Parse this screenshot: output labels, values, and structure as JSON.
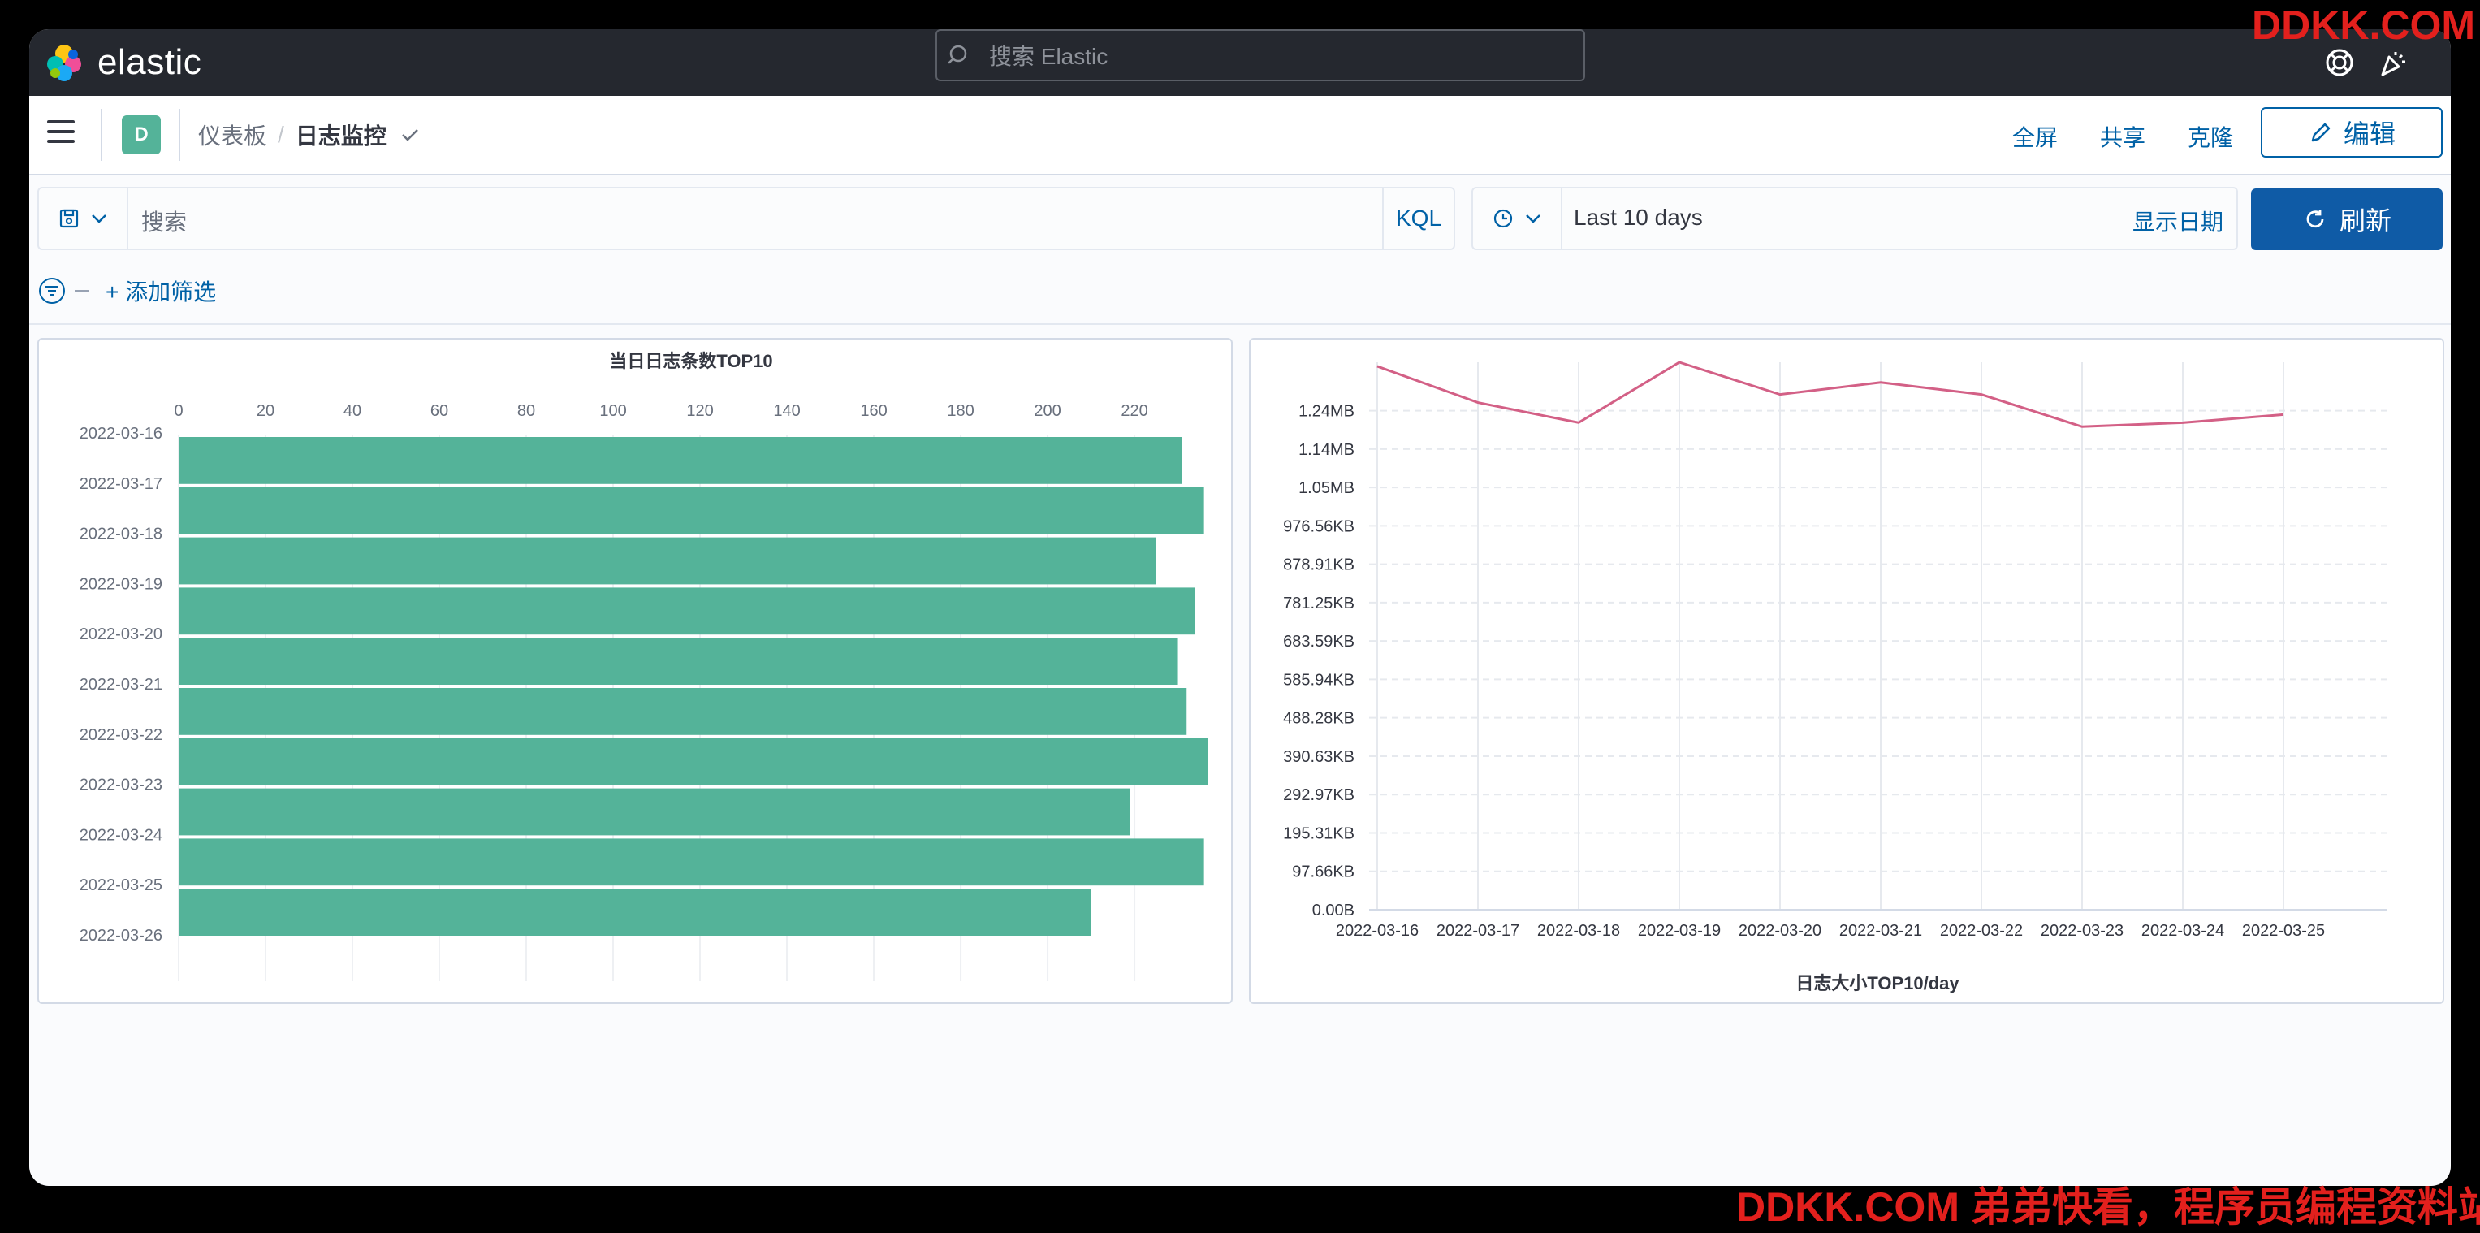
{
  "header": {
    "logo_text": "elastic",
    "search_placeholder": "搜索 Elastic",
    "help_icon": "lifebuoy-icon",
    "news_icon": "party-icon"
  },
  "nav": {
    "space_badge": "D",
    "breadcrumb_root": "仪表板",
    "breadcrumb_separator": "/",
    "breadcrumb_current": "日志监控",
    "fullscreen": "全屏",
    "share": "共享",
    "clone": "克隆",
    "edit": "编辑"
  },
  "query": {
    "placeholder": "搜索",
    "language": "KQL"
  },
  "time": {
    "range": "Last 10 days",
    "show_dates": "显示日期",
    "refresh": "刷新"
  },
  "filters": {
    "add_label": "+ 添加筛选"
  },
  "colors": {
    "bar": "#54b399",
    "line": "#d36086",
    "accent": "#0061a6",
    "refresh_bg": "#0f5ba6"
  },
  "watermark": {
    "top": "DDKK.COM",
    "bottom": "DDKK.COM 弟弟快看，程序员编程资料站"
  },
  "chart_data": [
    {
      "type": "bar",
      "orientation": "horizontal",
      "title": "当日日志条数TOP10",
      "categories": [
        "2022-03-16",
        "2022-03-17",
        "2022-03-18",
        "2022-03-19",
        "2022-03-20",
        "2022-03-21",
        "2022-03-22",
        "2022-03-23",
        "2022-03-24",
        "2022-03-25",
        "2022-03-26"
      ],
      "values": [
        231,
        236,
        225,
        234,
        230,
        232,
        237,
        219,
        236,
        210
      ],
      "x_ticks": [
        0,
        20,
        40,
        60,
        80,
        100,
        120,
        140,
        160,
        180,
        200,
        220
      ],
      "xlim": [
        0,
        237
      ],
      "xlabel": "",
      "ylabel": "",
      "color": "#54b399",
      "grid": true
    },
    {
      "type": "line",
      "title": "日志大小TOP10/day",
      "x": [
        "2022-03-16",
        "2022-03-17",
        "2022-03-18",
        "2022-03-19",
        "2022-03-20",
        "2022-03-21",
        "2022-03-22",
        "2022-03-23",
        "2022-03-24",
        "2022-03-25"
      ],
      "values_mb": [
        1.35,
        1.26,
        1.21,
        1.36,
        1.28,
        1.31,
        1.28,
        1.2,
        1.21,
        1.23
      ],
      "y_ticks": [
        "0.00B",
        "97.66KB",
        "195.31KB",
        "292.97KB",
        "390.63KB",
        "488.28KB",
        "585.94KB",
        "683.59KB",
        "781.25KB",
        "878.91KB",
        "976.56KB",
        "1.05MB",
        "1.14MB",
        "1.24MB"
      ],
      "y_tick_values_mb": [
        0,
        0.09537,
        0.19073,
        0.2861,
        0.38147,
        0.47684,
        0.57221,
        0.66757,
        0.76294,
        0.85831,
        0.95367,
        1.04904,
        1.14441,
        1.23978
      ],
      "ylim_mb": [
        0,
        1.36
      ],
      "xlabel": "",
      "ylabel": "",
      "color": "#d36086",
      "grid": true
    }
  ]
}
